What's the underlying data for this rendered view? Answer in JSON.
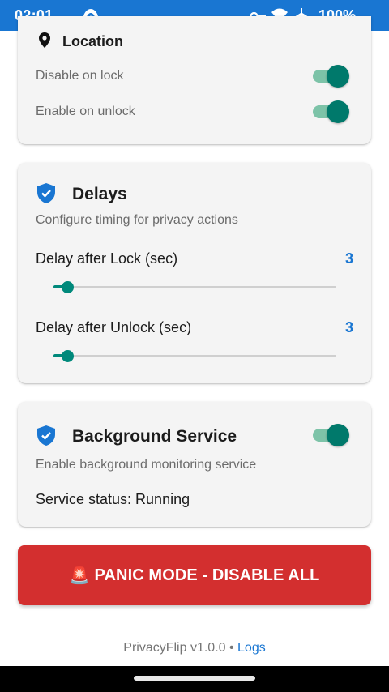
{
  "status_bar": {
    "time": "02:01",
    "battery": "100%"
  },
  "location": {
    "title": "Location",
    "rows": [
      {
        "label": "Disable on lock",
        "on": true
      },
      {
        "label": "Enable on unlock",
        "on": true
      }
    ]
  },
  "delays": {
    "title": "Delays",
    "subtitle": "Configure timing for privacy actions",
    "sliders": [
      {
        "label": "Delay after Lock (sec)",
        "value": "3",
        "fraction": 0.05
      },
      {
        "label": "Delay after Unlock (sec)",
        "value": "3",
        "fraction": 0.05
      }
    ]
  },
  "service": {
    "title": "Background Service",
    "subtitle": "Enable background monitoring service",
    "status": "Service status: Running",
    "on": true
  },
  "panic": {
    "emoji": "🚨",
    "label": "PANIC MODE - DISABLE ALL"
  },
  "footer": {
    "version": "PrivacyFlip v1.0.0 •",
    "logs_link": "Logs"
  },
  "colors": {
    "status_bar": "#1976d2",
    "accent": "#00796b",
    "accent_track": "#7dc3a8",
    "value_blue": "#1976d2",
    "panic_red": "#d32f2f"
  }
}
